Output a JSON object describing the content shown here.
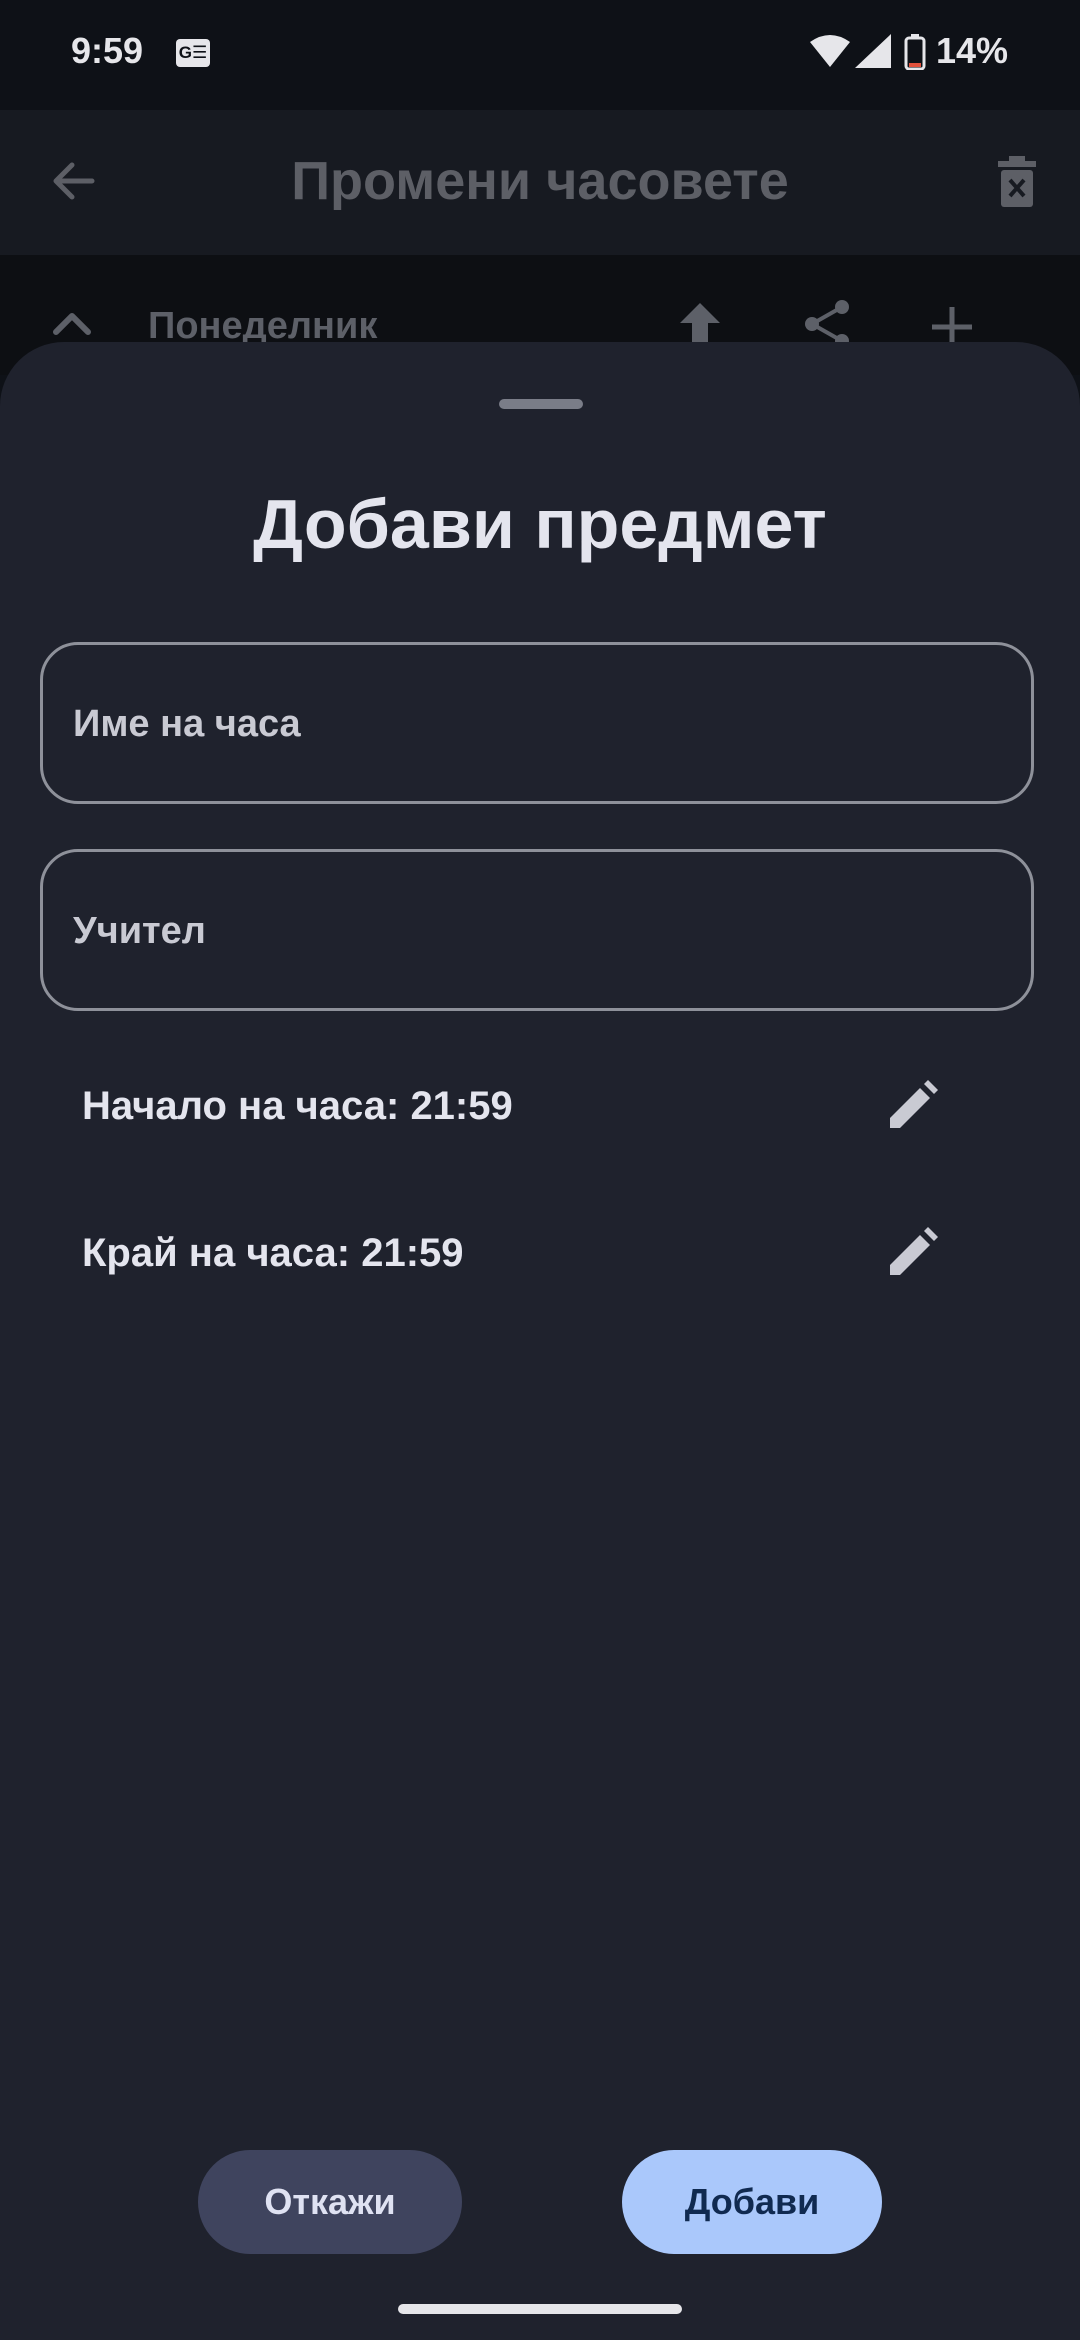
{
  "status_bar": {
    "time": "9:59",
    "notification_icon": "news-icon",
    "notification_glyph": "G☰",
    "battery": "14%"
  },
  "app_bar": {
    "title": "Промени часовете",
    "back_icon": "arrow-back-icon",
    "delete_icon": "delete-icon"
  },
  "day_row": {
    "label": "Понеделник",
    "icons": [
      "chevron-up-icon",
      "upload-icon",
      "share-icon",
      "add-icon"
    ]
  },
  "sheet": {
    "title": "Добави предмет",
    "name_field": {
      "placeholder": "Име на часа",
      "value": ""
    },
    "teacher_field": {
      "placeholder": "Учител",
      "value": ""
    },
    "start_time": "Начало на часа: 21:59",
    "end_time": "Край на часа: 21:59",
    "edit_icon": "edit-icon",
    "cancel_label": "Откажи",
    "add_label": "Добави"
  },
  "colors": {
    "sheet_background": "#1f222d",
    "cancel_button": "#3f445e",
    "add_button": "#aac8fb"
  }
}
